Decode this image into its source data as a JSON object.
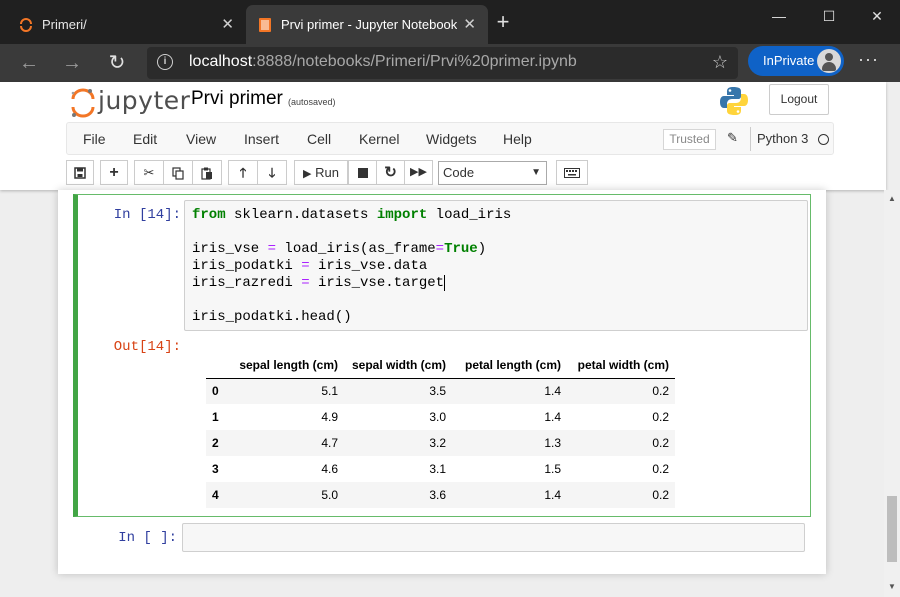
{
  "browser": {
    "tabs": [
      {
        "title": "Primeri/",
        "active": false
      },
      {
        "title": "Prvi primer - Jupyter Notebook",
        "active": true
      }
    ],
    "url_host": "localhost",
    "url_rest": ":8888/notebooks/Primeri/Prvi%20primer.ipynb",
    "inprivate_label": "InPrivate",
    "accent_color": "#0f62c7"
  },
  "header": {
    "logo_text": "jupyter",
    "notebook_name": "Prvi primer",
    "autosave_status": "(autosaved)",
    "logout_label": "Logout"
  },
  "menu": {
    "items": [
      "File",
      "Edit",
      "View",
      "Insert",
      "Cell",
      "Kernel",
      "Widgets",
      "Help"
    ],
    "trusted_label": "Trusted",
    "kernel_name": "Python 3"
  },
  "toolbar": {
    "run_label": "Run",
    "cell_type": "Code",
    "icons": [
      "save-icon",
      "add-cell-icon",
      "cut-icon",
      "copy-icon",
      "paste-icon",
      "move-up-icon",
      "move-down-icon",
      "run-icon",
      "stop-icon",
      "restart-icon",
      "fast-forward-icon",
      "keyboard-icon"
    ]
  },
  "cells": {
    "code_cell": {
      "in_prompt": "In [14]:",
      "out_prompt": "Out[14]:",
      "lines": [
        "from sklearn.datasets import load_iris",
        "",
        "iris_vse = load_iris(as_frame=True)",
        "iris_podatki = iris_vse.data",
        "iris_razredi = iris_vse.target",
        "",
        "iris_podatki.head()"
      ]
    },
    "dataframe": {
      "columns": [
        "",
        "sepal length (cm)",
        "sepal width (cm)",
        "petal length (cm)",
        "petal width (cm)"
      ],
      "rows": [
        [
          "0",
          "5.1",
          "3.5",
          "1.4",
          "0.2"
        ],
        [
          "1",
          "4.9",
          "3.0",
          "1.4",
          "0.2"
        ],
        [
          "2",
          "4.7",
          "3.2",
          "1.3",
          "0.2"
        ],
        [
          "3",
          "4.6",
          "3.1",
          "1.5",
          "0.2"
        ],
        [
          "4",
          "5.0",
          "3.6",
          "1.4",
          "0.2"
        ]
      ]
    },
    "empty_cell": {
      "in_prompt": "In [ ]:"
    }
  }
}
